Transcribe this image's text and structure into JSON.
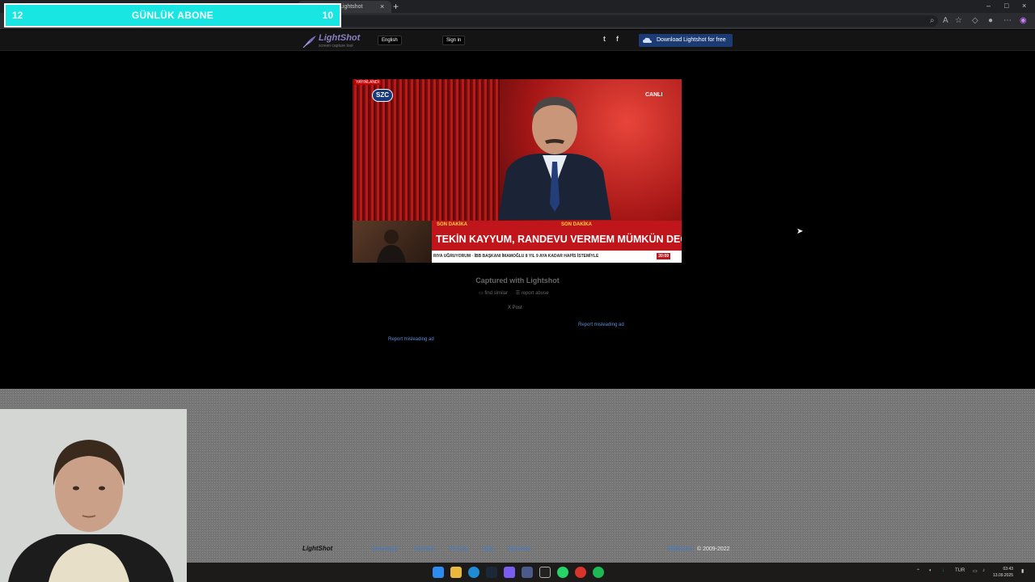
{
  "overlay": {
    "left_count": "12",
    "title": "GÜNLÜK ABONE",
    "right_count": "10"
  },
  "browser": {
    "tab_title": "Lightshot",
    "tab_close": "×",
    "new_tab": "+",
    "win_min": "–",
    "win_max": "□",
    "win_close": "×"
  },
  "header": {
    "logo_text": "LightShot",
    "logo_sub": "screen capture tool",
    "language": "English",
    "signin": "Sign in",
    "twitter": "t",
    "facebook": "f",
    "download": "Download Lightshot for free"
  },
  "screenshot": {
    "channel": "SZC",
    "live": "CANLI",
    "corner_tag": "YAYINLANDI",
    "son_dakika_1": "SON DAKİKA",
    "son_dakika_2": "SON DAKİKA",
    "headline": "TEKİN KAYYUM, RANDEVU VERMEM MÜMKÜN DEĞİL",
    "crawl": "RIYA UĞRUYORUM  ·  İBB BAŞKANI İMAMOĞLU 8 YIL 9 AYA KADAR HAPİS İSTEMİYLE",
    "crawl_time": "20:09"
  },
  "page": {
    "captured": "Captured with Lightshot",
    "find_similar": "find similar",
    "report_abuse": "report abuse",
    "x_post": "X Post",
    "report_ad_1": "Report misleading ad",
    "report_ad_2": "Report misleading ad"
  },
  "footer": {
    "logo": "LightShot",
    "links": [
      "Download",
      "Tutorials",
      "Privacy",
      "Help",
      "Advertise"
    ],
    "company": "Skillbrains",
    "copyright": "© 2009-2022"
  },
  "taskbar": {
    "lang": "TUR",
    "time": "03:43",
    "date": "13.09.2025"
  },
  "colors": {
    "overlay": "#17e6e2",
    "download_btn": "#1d3b73",
    "link": "#3d7fd4",
    "news_red": "#c0161b"
  }
}
